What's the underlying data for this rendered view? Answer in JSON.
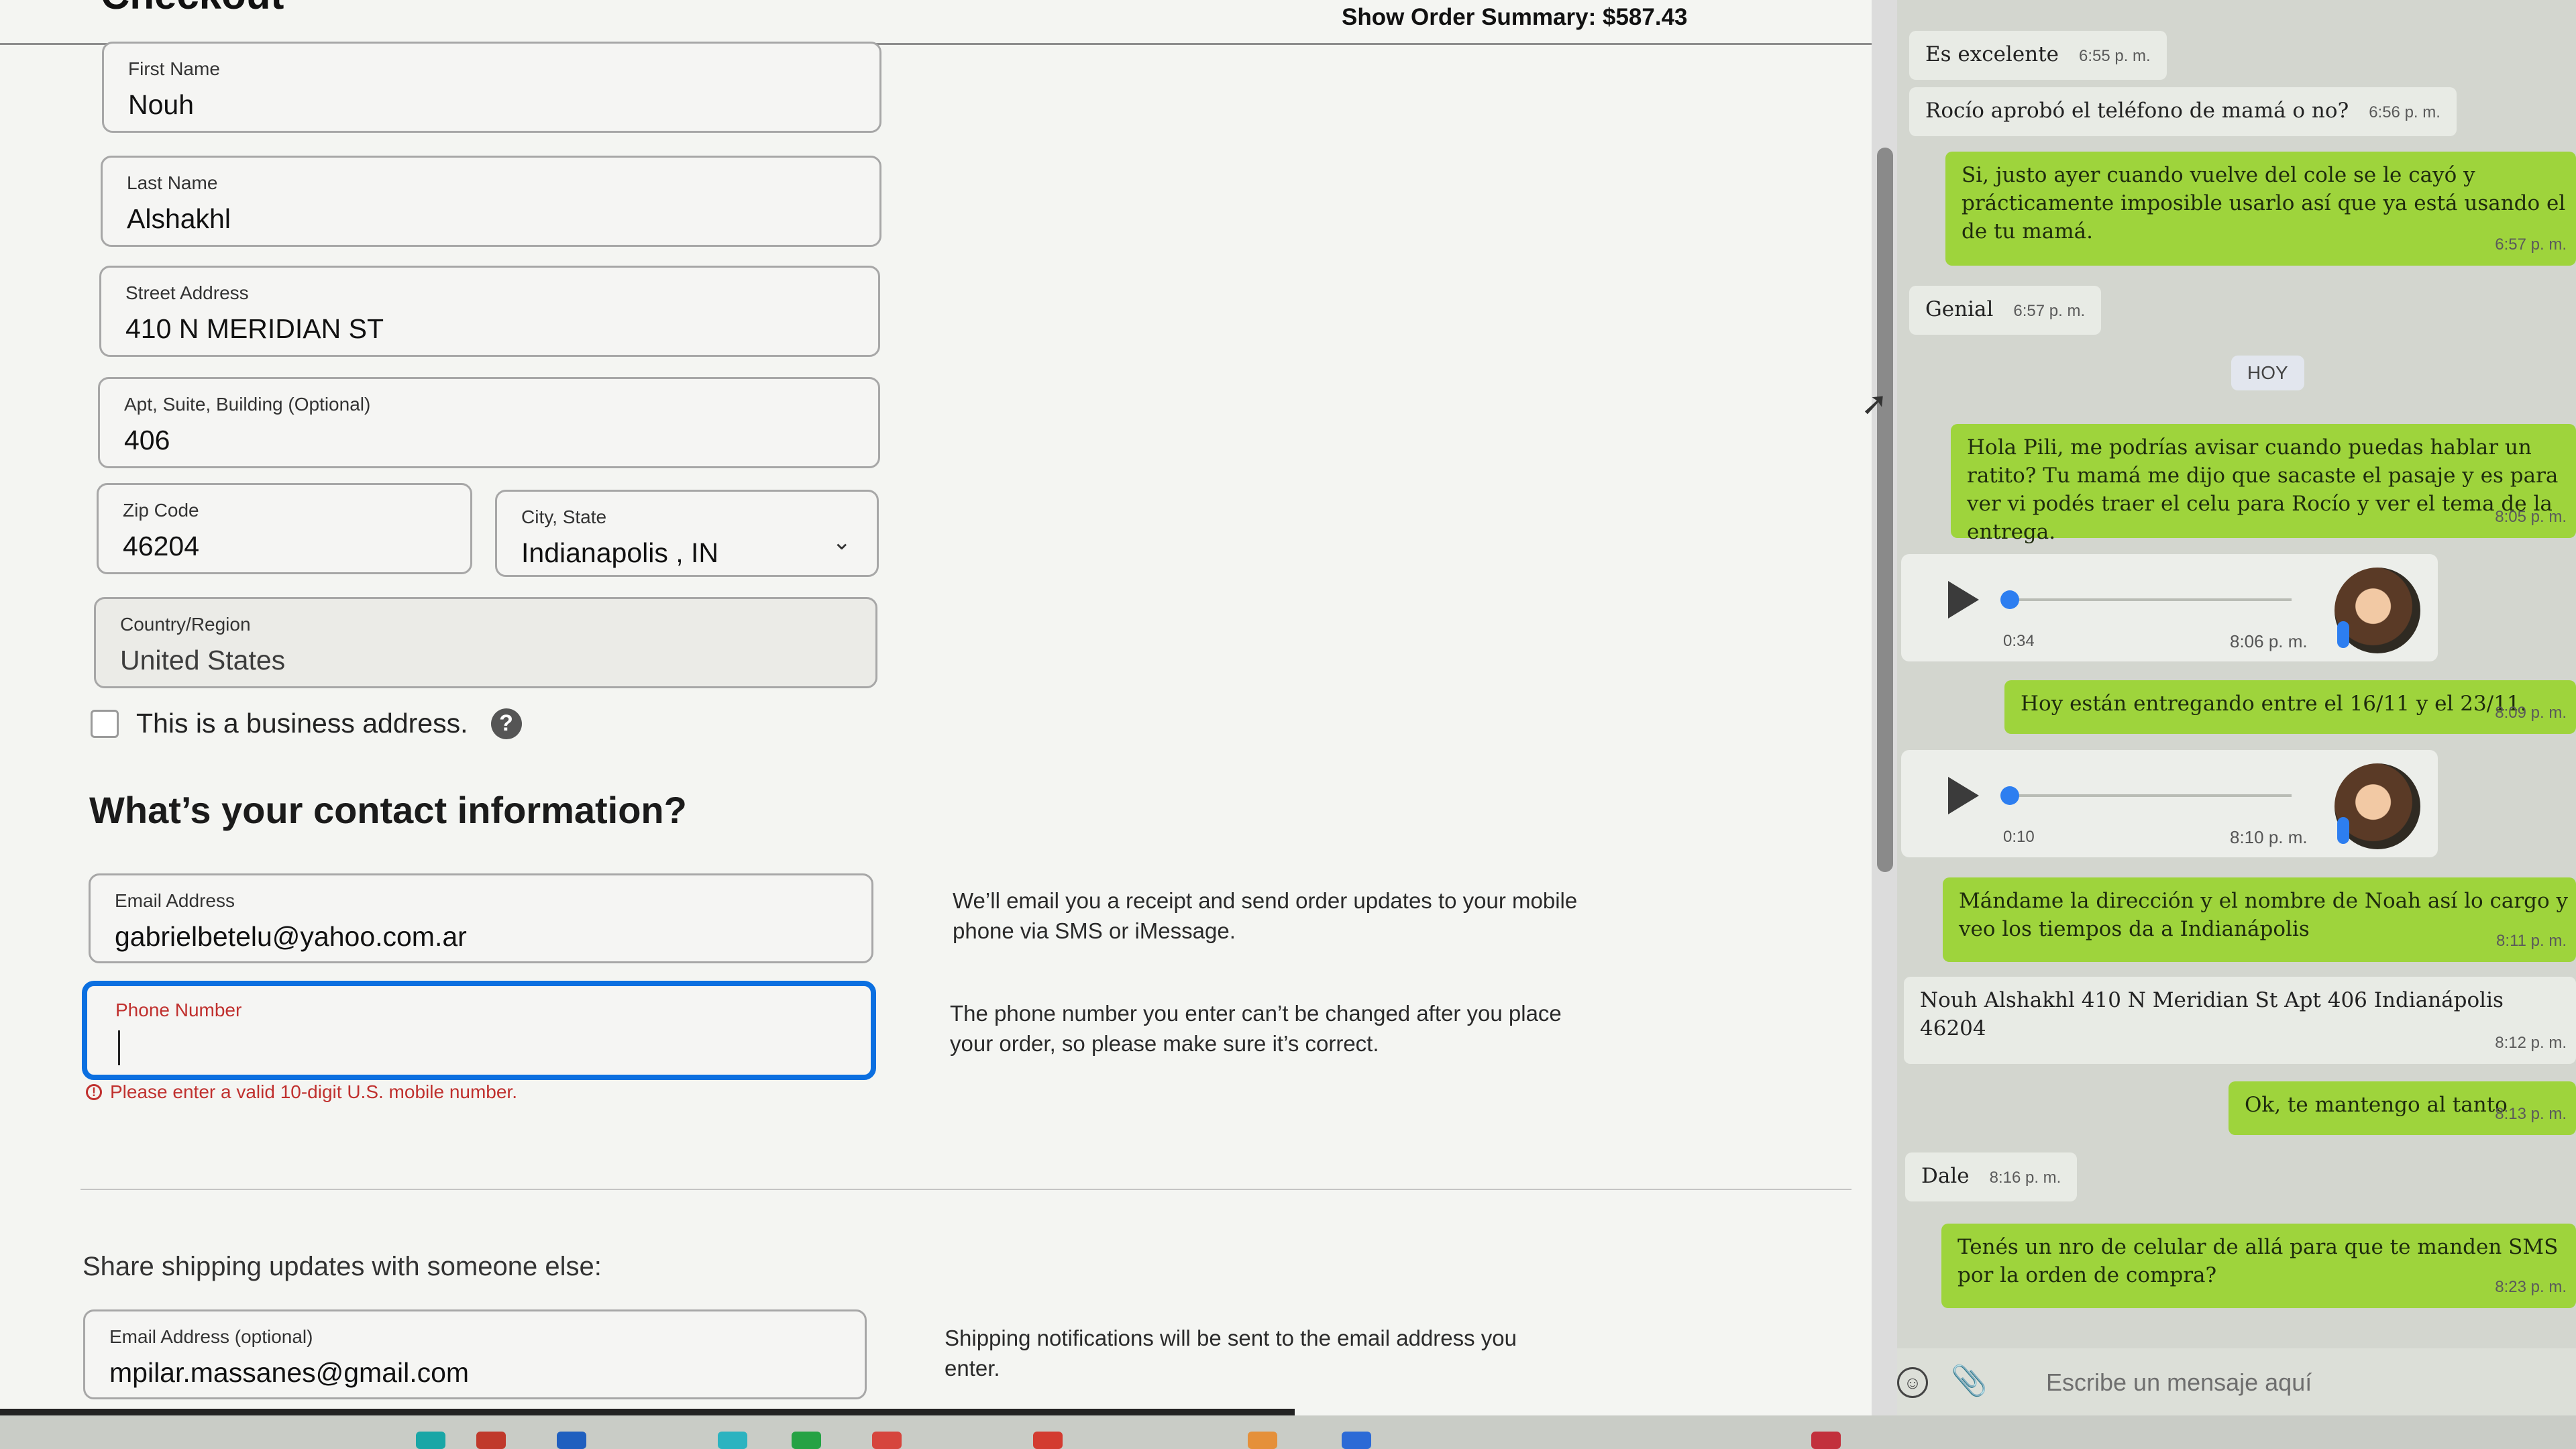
{
  "checkout": {
    "title": "Checkout",
    "order_summary": "Show Order Summary: $587.43",
    "fields": {
      "first_name": {
        "label": "First Name",
        "value": "Nouh"
      },
      "last_name": {
        "label": "Last Name",
        "value": "Alshakhl"
      },
      "street": {
        "label": "Street Address",
        "value": "410 N MERIDIAN ST"
      },
      "apt": {
        "label": "Apt, Suite, Building (Optional)",
        "value": "406"
      },
      "zip": {
        "label": "Zip Code",
        "value": "46204"
      },
      "city_state": {
        "label": "City, State",
        "value": "Indianapolis , IN"
      },
      "country": {
        "label": "Country/Region",
        "value": "United States"
      }
    },
    "business_checkbox_label": "This is a business address.",
    "contact_heading": "What’s your contact information?",
    "email": {
      "label": "Email Address",
      "value": "gabrielbetelu@yahoo.com.ar"
    },
    "email_note": "We’ll email you a receipt and send order updates to your mobile phone via SMS or iMessage.",
    "phone": {
      "label": "Phone Number",
      "value": ""
    },
    "phone_note": "The phone number you enter can’t be changed after you place your order, so please make sure it’s correct.",
    "phone_error": "Please enter a valid 10-digit U.S. mobile number.",
    "share_heading": "Share shipping updates with someone else:",
    "share_email": {
      "label": "Email Address (optional)",
      "value": "mpilar.massanes@gmail.com"
    },
    "share_note": "Shipping notifications will be sent to the email address you enter."
  },
  "chat": {
    "date_chip": "HOY",
    "messages": [
      {
        "text": "Es excelente",
        "time": "6:55 p. m."
      },
      {
        "text": "Rocío aprobó el teléfono de mamá o no?",
        "time": "6:56 p. m."
      },
      {
        "text": "Si, justo ayer cuando vuelve del cole se le cayó y prácticamente imposible usarlo así que ya está usando el de tu mamá.",
        "time": "6:57 p. m."
      },
      {
        "text": "Genial",
        "time": "6:57 p. m."
      },
      {
        "text": "Hola Pili, me podrías avisar cuando puedas hablar un ratito? Tu mamá me dijo que sacaste el pasaje y es para ver vi podés traer el celu para Rocío y ver el tema de la entrega.",
        "time": "8:05 p. m."
      },
      {
        "text": "Hoy están entregando entre el 16/11 y el 23/11.",
        "time": "8:09 p. m."
      },
      {
        "text": "Mándame la dirección y el nombre de Noah así lo cargo y veo los tiempos da a Indianápolis",
        "time": "8:11 p. m."
      },
      {
        "text": "Nouh Alshakhl 410 N Meridian St Apt 406 Indianápolis 46204",
        "time": "8:12 p. m."
      },
      {
        "text": "Ok, te mantengo al tanto",
        "time": "8:13 p. m."
      },
      {
        "text": "Dale",
        "time": "8:16 p. m."
      },
      {
        "text": "Tenés un nro de celular de allá para que te manden SMS por la orden de compra?",
        "time": "8:23 p. m."
      }
    ],
    "voice_notes": [
      {
        "duration": "0:34",
        "time": "8:06 p. m.",
        "progress": 0.0
      },
      {
        "duration": "0:10",
        "time": "8:10 p. m.",
        "progress": 0.0
      }
    ],
    "composer_placeholder": "Escribe un mensaje aquí",
    "colors": {
      "outgoing": "#9ed43c",
      "incoming": "#e8ebe5",
      "accent": "#2d7ef0"
    }
  },
  "colors": {
    "focus": "#0b6fe0",
    "error": "#c0302e"
  },
  "icons": [
    "help-icon",
    "error-icon",
    "chevron-down-icon",
    "play-icon",
    "mic-icon",
    "emoji-icon",
    "paperclip-icon",
    "mouse-cursor-icon"
  ]
}
